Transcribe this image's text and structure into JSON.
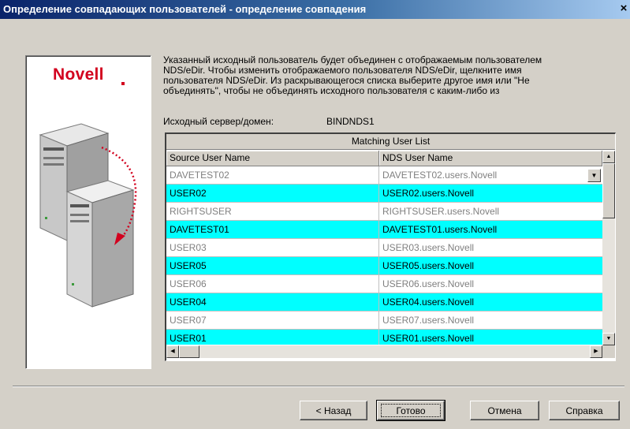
{
  "window": {
    "title": "Определение совпадающих пользователей - определение совпадения",
    "close_glyph": "×"
  },
  "logo": {
    "text": "Novell"
  },
  "description": "Указанный исходный пользователь будет объединен с отображаемым пользователем\nNDS/eDir.  Чтобы изменить отображаемого пользователя NDS/eDir, щелкните имя\nпользователя  NDS/eDir. Из раскрывающегося списка выберите другое имя или \"Не\nобъединять\", чтобы не объединять исходного пользователя с каким-либо из",
  "source_server": {
    "label": "Исходный сервер/домен:",
    "value": "BINDNDS1"
  },
  "grid": {
    "caption": "Matching User List",
    "columns": {
      "source": "Source User Name",
      "nds": "NDS User Name"
    },
    "rows": [
      {
        "source": "DAVETEST02",
        "nds": "DAVETEST02.users.Novell",
        "style": "dim",
        "dropdown": true
      },
      {
        "source": "USER02",
        "nds": "USER02.users.Novell",
        "style": "hl"
      },
      {
        "source": "RIGHTSUSER",
        "nds": "RIGHTSUSER.users.Novell",
        "style": "dim"
      },
      {
        "source": "DAVETEST01",
        "nds": "DAVETEST01.users.Novell",
        "style": "hl"
      },
      {
        "source": "USER03",
        "nds": "USER03.users.Novell",
        "style": "dim"
      },
      {
        "source": "USER05",
        "nds": "USER05.users.Novell",
        "style": "hl"
      },
      {
        "source": "USER06",
        "nds": "USER06.users.Novell",
        "style": "dim"
      },
      {
        "source": "USER04",
        "nds": "USER04.users.Novell",
        "style": "hl"
      },
      {
        "source": "USER07",
        "nds": "USER07.users.Novell",
        "style": "dim"
      },
      {
        "source": "USER01",
        "nds": "USER01.users.Novell",
        "style": "hl"
      }
    ]
  },
  "buttons": {
    "back": "< Назад",
    "finish": "Готово",
    "cancel": "Отмена",
    "help": "Справка"
  },
  "colors": {
    "highlight_row": "#00ffff",
    "brand_red": "#d2001e",
    "title_bar": "#0a246a"
  }
}
